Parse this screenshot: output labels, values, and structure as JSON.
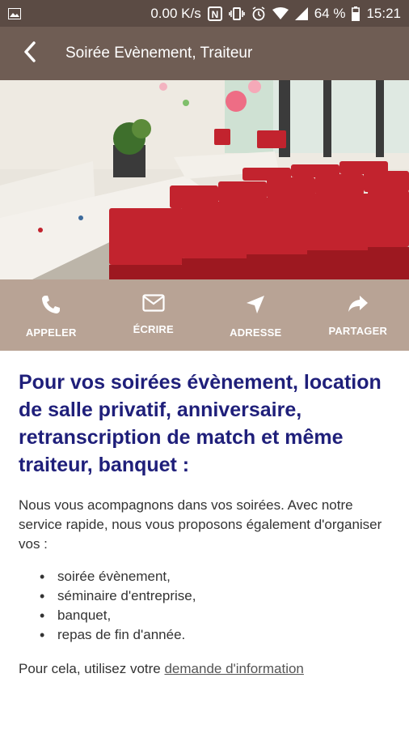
{
  "status_bar": {
    "speed": "0.00 K/s",
    "battery": "64 %",
    "time": "15:21",
    "icons": [
      "image-icon",
      "nfc-icon",
      "vibrate-icon",
      "alarm-icon",
      "wifi-icon",
      "signal-icon",
      "battery-icon"
    ]
  },
  "app_bar": {
    "title": "Soirée Evènement, Traiteur",
    "back_icon": "chevron-left-icon"
  },
  "hero": {
    "image": "banquet-hall-photo",
    "colors": {
      "wall": "#e8e4dc",
      "chair": "#c2232e",
      "tablecloth": "#f1eee8",
      "floor": "#b9b2a6"
    }
  },
  "actions": [
    {
      "icon": "phone-icon",
      "label": "APPELER"
    },
    {
      "icon": "mail-icon",
      "label": "ÉCRIRE"
    },
    {
      "icon": "location-arrow-icon",
      "label": "ADRESSE"
    },
    {
      "icon": "share-icon",
      "label": "PARTAGER"
    }
  ],
  "content": {
    "headline": "Pour vos soirées évènement, location de salle privatif, anniversaire, retranscription de match et même traiteur, banquet :",
    "intro": "Nous vous acompagnons dans vos soirées. Avec notre service rapide, nous vous proposons également d'organiser vos :",
    "bullets": [
      "soirée évènement,",
      "séminaire d'entreprise,",
      "banquet,",
      "repas de fin d'année."
    ],
    "footer_prefix": "Pour cela, utilisez votre ",
    "footer_link": "demande d'information"
  },
  "colors": {
    "status_bar": "#5b4b44",
    "app_bar": "#6f5d54",
    "action_bar": "#b8a395",
    "headline": "#1f1f7a",
    "body_text": "#333333"
  }
}
